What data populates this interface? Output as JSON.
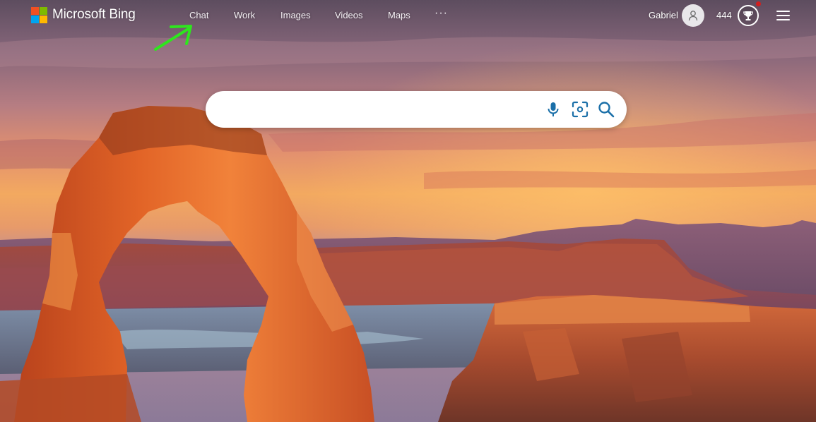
{
  "brand": {
    "name": "Microsoft Bing",
    "logo_colors": [
      "#f25022",
      "#7fba00",
      "#00a4ef",
      "#ffb900"
    ]
  },
  "nav": {
    "items": [
      {
        "label": "Chat"
      },
      {
        "label": "Work"
      },
      {
        "label": "Images"
      },
      {
        "label": "Videos"
      },
      {
        "label": "Maps"
      }
    ],
    "more_label": "···"
  },
  "user": {
    "name": "Gabriel",
    "points": "444"
  },
  "search": {
    "value": "",
    "placeholder": "",
    "icons": [
      "microphone-icon",
      "visual-search-icon",
      "search-icon"
    ],
    "icon_color": "#1a6fa8"
  },
  "annotation": {
    "arrow_color": "#2ee61e"
  },
  "background": {
    "subject": "desert-arch-sunset"
  }
}
